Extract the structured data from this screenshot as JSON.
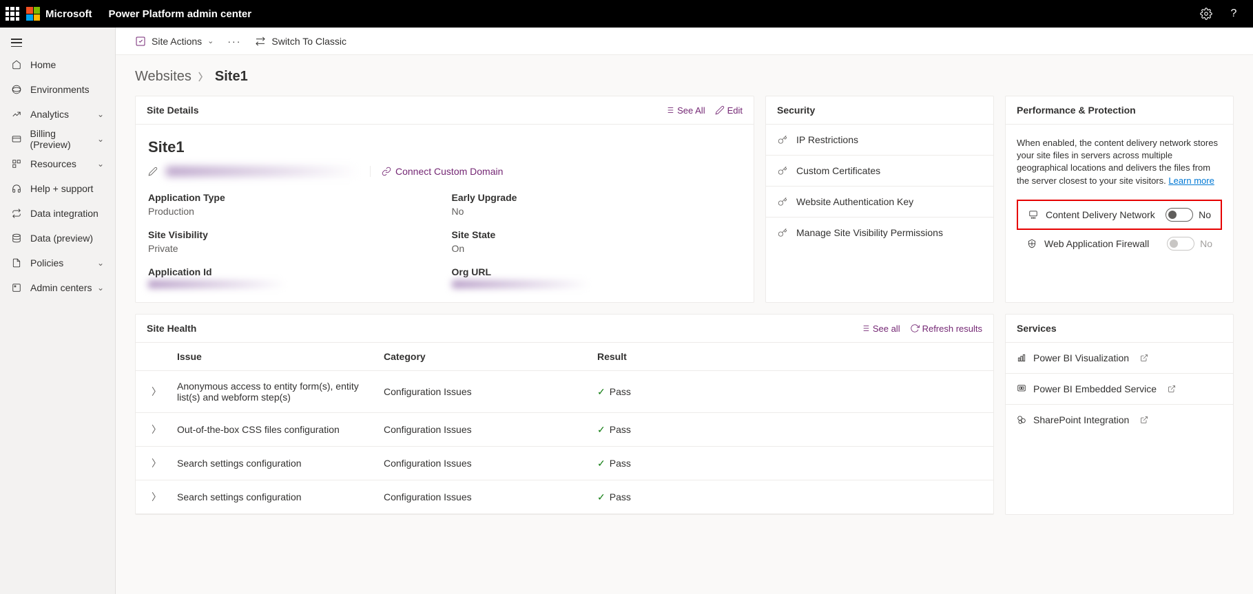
{
  "header": {
    "brand": "Microsoft",
    "title": "Power Platform admin center"
  },
  "sidebar": {
    "items": [
      {
        "label": "Home",
        "icon": "home",
        "chevron": false
      },
      {
        "label": "Environments",
        "icon": "environments",
        "chevron": false
      },
      {
        "label": "Analytics",
        "icon": "analytics",
        "chevron": true
      },
      {
        "label": "Billing (Preview)",
        "icon": "billing",
        "chevron": true
      },
      {
        "label": "Resources",
        "icon": "resources",
        "chevron": true
      },
      {
        "label": "Help + support",
        "icon": "support",
        "chevron": false
      },
      {
        "label": "Data integration",
        "icon": "data-integration",
        "chevron": false
      },
      {
        "label": "Data (preview)",
        "icon": "data-preview",
        "chevron": false
      },
      {
        "label": "Policies",
        "icon": "policies",
        "chevron": true
      },
      {
        "label": "Admin centers",
        "icon": "admin-centers",
        "chevron": true
      }
    ]
  },
  "toolbar": {
    "site_actions": "Site Actions",
    "switch_classic": "Switch To Classic"
  },
  "breadcrumb": {
    "parent": "Websites",
    "current": "Site1"
  },
  "site_details": {
    "card_title": "Site Details",
    "see_all": "See All",
    "edit": "Edit",
    "title": "Site1",
    "connect_domain": "Connect Custom Domain",
    "fields": {
      "app_type_label": "Application Type",
      "app_type_value": "Production",
      "early_upgrade_label": "Early Upgrade",
      "early_upgrade_value": "No",
      "site_visibility_label": "Site Visibility",
      "site_visibility_value": "Private",
      "site_state_label": "Site State",
      "site_state_value": "On",
      "app_id_label": "Application Id",
      "org_url_label": "Org URL"
    }
  },
  "security": {
    "card_title": "Security",
    "items": [
      "IP Restrictions",
      "Custom Certificates",
      "Website Authentication Key",
      "Manage Site Visibility Permissions"
    ]
  },
  "performance": {
    "card_title": "Performance & Protection",
    "description": "When enabled, the content delivery network stores your site files in servers across multiple geographical locations and delivers the files from the server closest to your site visitors. ",
    "learn_more": "Learn more",
    "cdn_label": "Content Delivery Network",
    "cdn_value": "No",
    "waf_label": "Web Application Firewall",
    "waf_value": "No"
  },
  "site_health": {
    "card_title": "Site Health",
    "see_all": "See all",
    "refresh": "Refresh results",
    "columns": {
      "issue": "Issue",
      "category": "Category",
      "result": "Result"
    },
    "rows": [
      {
        "issue": "Anonymous access to entity form(s), entity list(s) and webform step(s)",
        "category": "Configuration Issues",
        "result": "Pass"
      },
      {
        "issue": "Out-of-the-box CSS files configuration",
        "category": "Configuration Issues",
        "result": "Pass"
      },
      {
        "issue": "Search settings configuration",
        "category": "Configuration Issues",
        "result": "Pass"
      },
      {
        "issue": "Search settings configuration",
        "category": "Configuration Issues",
        "result": "Pass"
      }
    ]
  },
  "services": {
    "card_title": "Services",
    "items": [
      "Power BI Visualization",
      "Power BI Embedded Service",
      "SharePoint Integration"
    ]
  }
}
